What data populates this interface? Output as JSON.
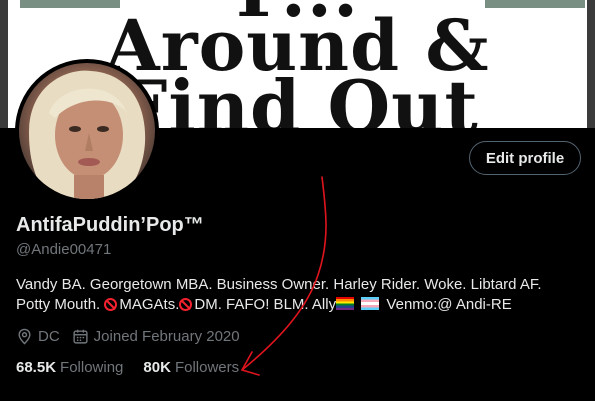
{
  "banner": {
    "line1": "F...",
    "line2": "Around &",
    "line3": "Find Out"
  },
  "profile": {
    "edit_button": "Edit profile",
    "display_name": "AntifaPuddin’Pop™",
    "handle": "@Andie00471",
    "bio_line1": "Vandy BA. Georgetown MBA. Business Owner. Harley Rider. Woke. Libtard AF.",
    "bio_line2_a": "Potty Mouth. ",
    "bio_line2_b": "MAGAts.",
    "bio_line2_c": "DM. FAFO! BLM. Ally",
    "bio_line2_d": "Venmo:@ Andi-RE",
    "location": "DC",
    "joined": "Joined February 2020",
    "following_count": "68.5K",
    "following_label": "Following",
    "followers_count": "80K",
    "followers_label": "Followers"
  },
  "icons": {
    "location": "location-pin-icon",
    "calendar": "calendar-icon",
    "no_entry": "prohibited-icon",
    "rainbow_flag": "rainbow-flag-icon",
    "trans_flag": "transgender-flag-icon"
  },
  "colors": {
    "background": "#000000",
    "text_primary": "#e7e9ea",
    "text_secondary": "#71767b",
    "button_border": "#536471",
    "annotation_red": "#e0141e"
  }
}
